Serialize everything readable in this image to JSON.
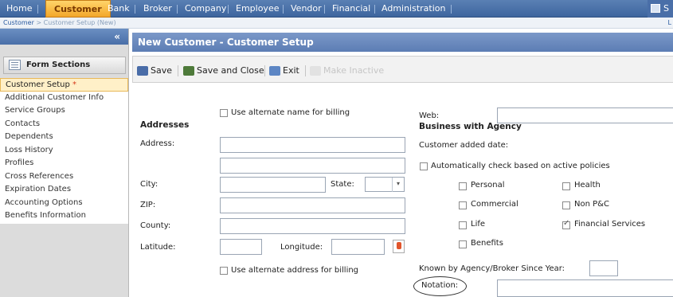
{
  "nav": {
    "items": [
      "Home",
      "Customer",
      "Bank",
      "Broker",
      "Company",
      "Employee",
      "Vendor",
      "Financial",
      "Administration"
    ],
    "active": "Customer",
    "right_label": "S"
  },
  "breadcrumb": {
    "link": "Customer",
    "separator": ">",
    "current": "Customer Setup (New)",
    "right": "L"
  },
  "sidebar": {
    "collapse_glyph": "«",
    "sections_title": "Form Sections",
    "items": [
      {
        "label": "Customer Setup",
        "required": "*",
        "active": true
      },
      {
        "label": "Additional Customer Info"
      },
      {
        "label": "Service Groups"
      },
      {
        "label": "Contacts"
      },
      {
        "label": "Dependents"
      },
      {
        "label": "Loss History"
      },
      {
        "label": "Profiles"
      },
      {
        "label": "Cross References"
      },
      {
        "label": "Expiration Dates"
      },
      {
        "label": "Accounting Options"
      },
      {
        "label": "Benefits Information"
      }
    ]
  },
  "page_title": "New Customer - Customer Setup",
  "toolbar": {
    "save": "Save",
    "save_close": "Save and Close",
    "exit": "Exit",
    "make_inactive": "Make Inactive"
  },
  "form": {
    "alt_name_billing": "Use alternate name for billing",
    "web_label": "Web:",
    "addresses_heading": "Addresses",
    "address_label": "Address:",
    "city_label": "City:",
    "state_label": "State:",
    "zip_label": "ZIP:",
    "county_label": "County:",
    "latitude_label": "Latitude:",
    "longitude_label": "Longitude:",
    "alt_address_billing": "Use alternate address for billing",
    "business_heading": "Business with Agency",
    "customer_added_date": "Customer added date:",
    "auto_check": "Automatically check based on active policies",
    "policies": {
      "personal": "Personal",
      "health": "Health",
      "commercial": "Commercial",
      "non_pc": "Non P&C",
      "life": "Life",
      "financial_services": "Financial Services",
      "benefits": "Benefits"
    },
    "known_since": "Known by Agency/Broker Since Year:",
    "notation_label": "Notation:"
  },
  "colors": {
    "nav_bg": "#3d659e",
    "nav_active": "#f3a72a",
    "title_bar": "#5c7db4",
    "active_section": "#fff0c8"
  }
}
